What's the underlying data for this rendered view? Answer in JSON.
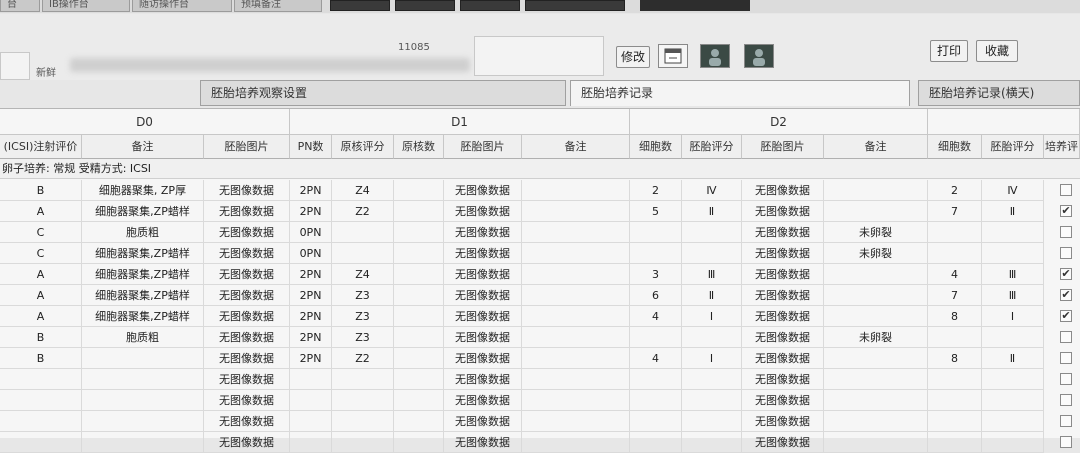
{
  "top_tabs": [
    "台",
    "IB操作台",
    "随访操作台",
    "预填备注"
  ],
  "header": {
    "fresh_label": "新鲜",
    "partial_id": "11085",
    "buttons": {
      "modify": "修改",
      "print": "打印",
      "withdraw": "收藏"
    }
  },
  "tabs": [
    "胚胎培养观察设置",
    "胚胎培养记录",
    "胚胎培养记录(横天)"
  ],
  "days": [
    "D0",
    "D1",
    "D2"
  ],
  "columns": {
    "d0": [
      "(ICSI)注射评价",
      "备注",
      "胚胎图片"
    ],
    "d1": [
      "PN数",
      "原核评分",
      "原核数",
      "胚胎图片",
      "备注"
    ],
    "d2": [
      "细胞数",
      "胚胎评分",
      "胚胎图片",
      "备注"
    ],
    "d3": [
      "细胞数",
      "胚胎评分",
      "培养评"
    ]
  },
  "group_label": "卵子培养: 常规  受精方式: ICSI",
  "rows": [
    {
      "grade": "B",
      "note": "细胞器聚集, ZP厚",
      "img0": "无图像数据",
      "pn": "2PN",
      "pn_score": "Z4",
      "img1": "无图像数据",
      "cells2": "2",
      "score2": "Ⅳ",
      "img2": "无图像数据",
      "note2": "",
      "cells3": "2",
      "score3": "Ⅳ",
      "check": ""
    },
    {
      "grade": "A",
      "note": "细胞器聚集,ZP蜡样",
      "img0": "无图像数据",
      "pn": "2PN",
      "pn_score": "Z2",
      "img1": "无图像数据",
      "cells2": "5",
      "score2": "Ⅱ",
      "img2": "无图像数据",
      "note2": "",
      "cells3": "7",
      "score3": "Ⅱ",
      "check": "✔"
    },
    {
      "grade": "C",
      "note": "胞质粗",
      "img0": "无图像数据",
      "pn": "0PN",
      "pn_score": "",
      "img1": "无图像数据",
      "cells2": "",
      "score2": "",
      "img2": "无图像数据",
      "note2": "未卵裂",
      "cells3": "",
      "score3": "",
      "check": ""
    },
    {
      "grade": "C",
      "note": "细胞器聚集,ZP蜡样",
      "img0": "无图像数据",
      "pn": "0PN",
      "pn_score": "",
      "img1": "无图像数据",
      "cells2": "",
      "score2": "",
      "img2": "无图像数据",
      "note2": "未卵裂",
      "cells3": "",
      "score3": "",
      "check": ""
    },
    {
      "grade": "A",
      "note": "细胞器聚集,ZP蜡样",
      "img0": "无图像数据",
      "pn": "2PN",
      "pn_score": "Z4",
      "img1": "无图像数据",
      "cells2": "3",
      "score2": "Ⅲ",
      "img2": "无图像数据",
      "note2": "",
      "cells3": "4",
      "score3": "Ⅲ",
      "check": "✔"
    },
    {
      "grade": "A",
      "note": "细胞器聚集,ZP蜡样",
      "img0": "无图像数据",
      "pn": "2PN",
      "pn_score": "Z3",
      "img1": "无图像数据",
      "cells2": "6",
      "score2": "Ⅱ",
      "img2": "无图像数据",
      "note2": "",
      "cells3": "7",
      "score3": "Ⅲ",
      "check": "✔"
    },
    {
      "grade": "A",
      "note": "细胞器聚集,ZP蜡样",
      "img0": "无图像数据",
      "pn": "2PN",
      "pn_score": "Z3",
      "img1": "无图像数据",
      "cells2": "4",
      "score2": "Ⅰ",
      "img2": "无图像数据",
      "note2": "",
      "cells3": "8",
      "score3": "Ⅰ",
      "check": "✔"
    },
    {
      "grade": "B",
      "note": "胞质粗",
      "img0": "无图像数据",
      "pn": "2PN",
      "pn_score": "Z3",
      "img1": "无图像数据",
      "cells2": "",
      "score2": "",
      "img2": "无图像数据",
      "note2": "未卵裂",
      "cells3": "",
      "score3": "",
      "check": ""
    },
    {
      "grade": "B",
      "note": "",
      "img0": "无图像数据",
      "pn": "2PN",
      "pn_score": "Z2",
      "img1": "无图像数据",
      "cells2": "4",
      "score2": "Ⅰ",
      "img2": "无图像数据",
      "note2": "",
      "cells3": "8",
      "score3": "Ⅱ",
      "check": ""
    },
    {
      "grade": "",
      "note": "",
      "img0": "无图像数据",
      "pn": "",
      "pn_score": "",
      "img1": "无图像数据",
      "cells2": "",
      "score2": "",
      "img2": "无图像数据",
      "note2": "",
      "cells3": "",
      "score3": "",
      "check": ""
    },
    {
      "grade": "",
      "note": "",
      "img0": "无图像数据",
      "pn": "",
      "pn_score": "",
      "img1": "无图像数据",
      "cells2": "",
      "score2": "",
      "img2": "无图像数据",
      "note2": "",
      "cells3": "",
      "score3": "",
      "check": ""
    },
    {
      "grade": "",
      "note": "",
      "img0": "无图像数据",
      "pn": "",
      "pn_score": "",
      "img1": "无图像数据",
      "cells2": "",
      "score2": "",
      "img2": "无图像数据",
      "note2": "",
      "cells3": "",
      "score3": "",
      "check": ""
    },
    {
      "grade": "",
      "note": "",
      "img0": "无图像数据",
      "pn": "",
      "pn_score": "",
      "img1": "无图像数据",
      "cells2": "",
      "score2": "",
      "img2": "无图像数据",
      "note2": "",
      "cells3": "",
      "score3": "",
      "check": ""
    }
  ]
}
